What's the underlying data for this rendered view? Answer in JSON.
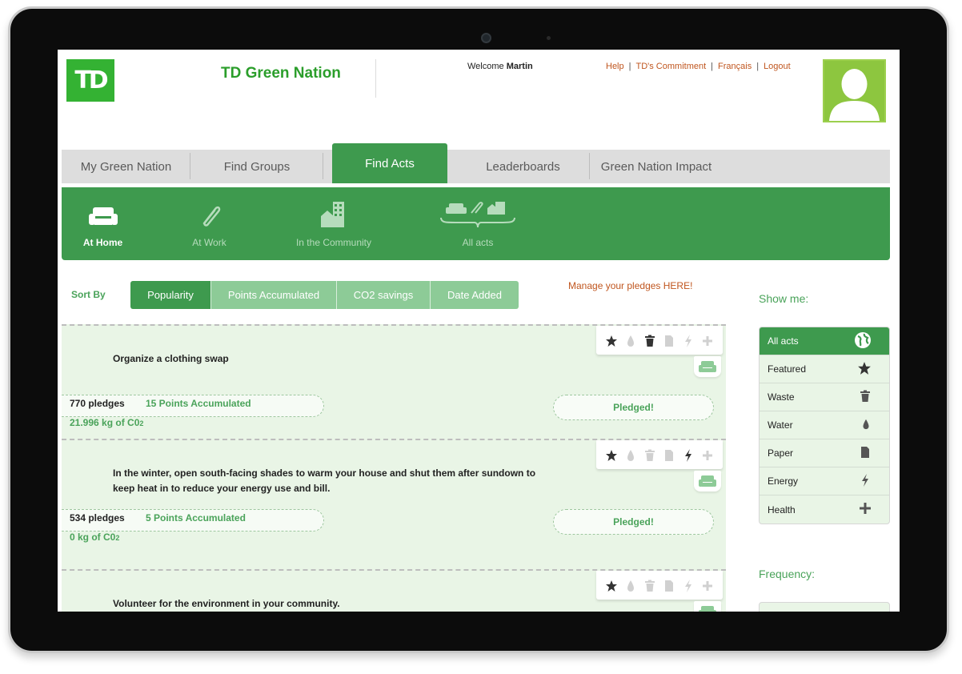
{
  "brand": {
    "logo_text": "TD",
    "site_title": "TD Green Nation"
  },
  "header": {
    "welcome_prefix": "Welcome",
    "user_name": "Martin",
    "links": [
      "Help",
      "TD's Commitment",
      "Français",
      "Logout"
    ],
    "link_separator": "|"
  },
  "tabs": [
    {
      "label": "My Green Nation"
    },
    {
      "label": "Find Groups"
    },
    {
      "label": "Find Acts",
      "active": true
    },
    {
      "label": "Leaderboards"
    },
    {
      "label": "Green Nation Impact"
    }
  ],
  "categories": [
    {
      "label": "At Home",
      "icon": "sofa-icon",
      "active": true
    },
    {
      "label": "At Work",
      "icon": "paperclip-icon"
    },
    {
      "label": "In the Community",
      "icon": "buildings-icon"
    },
    {
      "label": "All acts",
      "icon": "all-acts-icon"
    }
  ],
  "sort": {
    "label": "Sort By",
    "options": [
      "Popularity",
      "Points Accumulated",
      "CO2 savings",
      "Date Added"
    ],
    "selected": "Popularity"
  },
  "manage_link": "Manage your pledges HERE!",
  "acts": [
    {
      "title": "Organize a clothing swap",
      "pledges": "770 pledges",
      "points": "15 Points Accumulated",
      "co2_value": "21.996 kg of C0",
      "co2_sub": "2",
      "button": "Pledged!",
      "active_icons": [
        "star-icon",
        "trash-icon"
      ]
    },
    {
      "title": "In the winter, open south-facing shades to warm your house and shut them after sundown to keep heat in to reduce your energy use and bill.",
      "pledges": "534 pledges",
      "points": "5 Points Accumulated",
      "co2_value": "0 kg of C0",
      "co2_sub": "2",
      "button": "Pledged!",
      "active_icons": [
        "star-icon",
        "lightning-icon"
      ]
    },
    {
      "title": "Volunteer for the environment in your community.",
      "active_icons": [
        "star-icon"
      ]
    }
  ],
  "sidebar": {
    "show_me_label": "Show me:",
    "filters": [
      {
        "label": "All acts",
        "icon": "globe-icon",
        "active": true
      },
      {
        "label": "Featured",
        "icon": "star-icon"
      },
      {
        "label": "Waste",
        "icon": "trash-icon"
      },
      {
        "label": "Water",
        "icon": "water-drop-icon"
      },
      {
        "label": "Paper",
        "icon": "paper-icon"
      },
      {
        "label": "Energy",
        "icon": "lightning-icon"
      },
      {
        "label": "Health",
        "icon": "plus-icon"
      }
    ],
    "frequency_label": "Frequency:"
  },
  "colors": {
    "brand_green": "#34b233",
    "primary_green": "#3e9a4e",
    "light_green": "#8dcb97",
    "link_orange": "#c0561f",
    "act_bg": "#e9f5e6"
  }
}
